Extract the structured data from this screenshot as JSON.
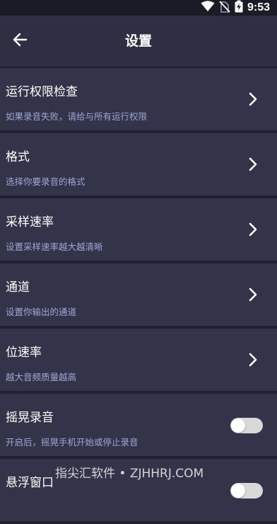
{
  "status_bar": {
    "time": "9:53",
    "icons": [
      "wifi-icon",
      "no-sim-icon",
      "battery-charging-icon"
    ]
  },
  "app_bar": {
    "back_icon": "arrow-left-icon",
    "title": "设置"
  },
  "settings": [
    {
      "title": "运行权限检查",
      "subtitle": "如果录音失败，请给与所有运行权限",
      "control": "chevron"
    },
    {
      "title": "格式",
      "subtitle": "选择你要录音的格式",
      "control": "chevron"
    },
    {
      "title": "采样速率",
      "subtitle": "设置采样速率越大越清晰",
      "control": "chevron"
    },
    {
      "title": "通道",
      "subtitle": "设置你输出的通道",
      "control": "chevron"
    },
    {
      "title": "位速率",
      "subtitle": "越大音频质量越高",
      "control": "chevron"
    },
    {
      "title": "摇晃录音",
      "subtitle": "开启后，摇晃手机开始或停止录音",
      "control": "toggle",
      "on": false
    },
    {
      "title": "悬浮窗口",
      "subtitle": "",
      "control": "toggle",
      "on": false
    }
  ],
  "watermark": "指尖汇软件 • ZJHHRJ.COM",
  "colors": {
    "background": "#202030",
    "app_bar": "#2f2f44",
    "item_background": "#33334a",
    "subtitle_text": "#9fa6d4",
    "toggle_off": "#d9d9d9"
  }
}
